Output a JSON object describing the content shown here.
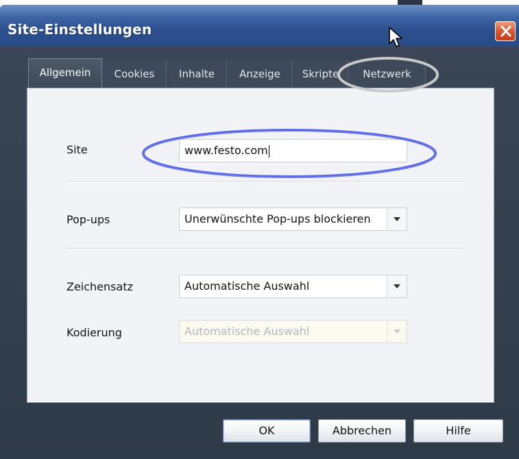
{
  "window": {
    "title": "Site-Einstellungen"
  },
  "tabs": [
    {
      "label": "Allgemein",
      "active": true
    },
    {
      "label": "Cookies",
      "active": false
    },
    {
      "label": "Inhalte",
      "active": false
    },
    {
      "label": "Anzeige",
      "active": false
    },
    {
      "label": "Skripte",
      "active": false
    },
    {
      "label": "Netzwerk",
      "active": false
    }
  ],
  "form": {
    "site_label": "Site",
    "site_value": "www.festo.com",
    "popups_label": "Pop-ups",
    "popups_value": "Unerwünschte Pop-ups blockieren",
    "charset_label": "Zeichensatz",
    "charset_value": "Automatische Auswahl",
    "encoding_label": "Kodierung",
    "encoding_value": "Automatische Auswahl"
  },
  "buttons": {
    "ok": "OK",
    "cancel": "Abbrechen",
    "help": "Hilfe"
  },
  "colors": {
    "titlebar": "#2c4f8e",
    "frame": "#323d4c",
    "panel": "#f2f3f6",
    "highlight_site": "#5566e0",
    "highlight_tab": "#c8c8c8",
    "close": "#d9512c"
  },
  "icons": {
    "close": "close-x-icon",
    "cursor": "mouse-pointer-icon",
    "dropdown": "chevron-down-icon"
  }
}
